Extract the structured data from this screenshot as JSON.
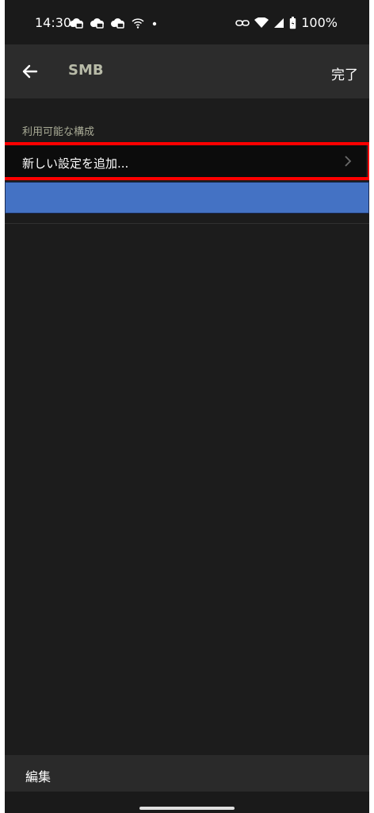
{
  "status_bar": {
    "time": "14:30",
    "battery_percent": "100%",
    "icons": [
      "cloud-chat-icon",
      "cloud-chat-icon",
      "cloud-chat-icon",
      "wifi-icon",
      "dot-icon",
      "link-icon",
      "wifi-signal-icon",
      "cell-signal-icon",
      "battery-icon"
    ]
  },
  "app_bar": {
    "title": "SMB",
    "done_label": "完了",
    "back_icon": "back-arrow-icon"
  },
  "section": {
    "header": "利用可能な構成",
    "items": [
      {
        "label": "新しい設定を追加...",
        "icon": "chevron-right-icon"
      }
    ]
  },
  "bottom_bar": {
    "edit_label": "編集"
  },
  "colors": {
    "background": "#1c1c1c",
    "app_bar": "#2c2c2c",
    "title": "#b8bba8",
    "highlight": "#ff0000",
    "blue_bar": "#4472c4"
  }
}
